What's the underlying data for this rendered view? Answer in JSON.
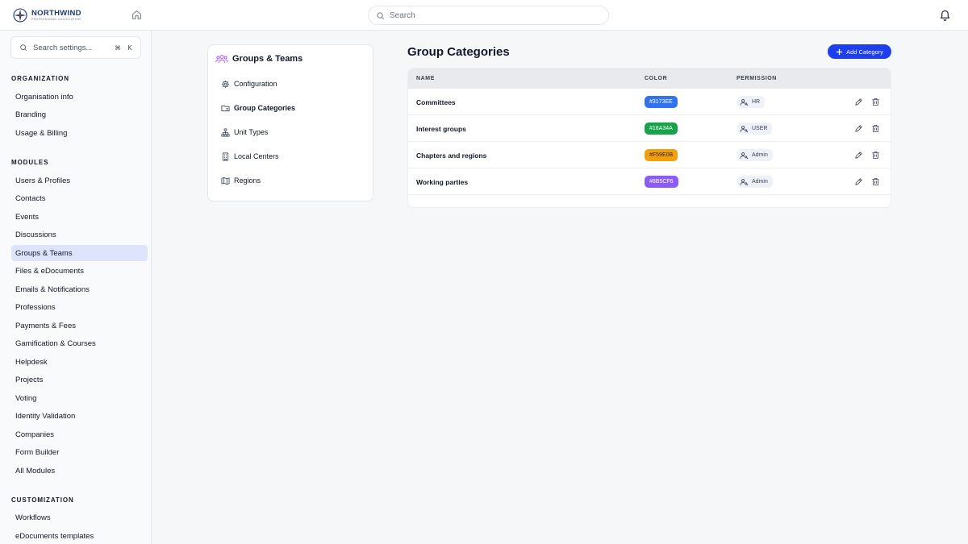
{
  "brand": {
    "name": "NORTHWIND",
    "tagline": "PROFESSIONAL ASSOCIATION"
  },
  "topbar": {
    "search_placeholder": "Search"
  },
  "sidebar": {
    "search_placeholder": "Search settings...",
    "shortcut": [
      "⌘",
      "K"
    ],
    "sections": [
      {
        "title": "ORGANIZATION",
        "items": [
          "Organisation info",
          "Branding",
          "Usage & Billing"
        ]
      },
      {
        "title": "MODULES",
        "items": [
          "Users & Profiles",
          "Contacts",
          "Events",
          "Discussions",
          "Groups & Teams",
          "Files & eDocuments",
          "Emails & Notifications",
          "Professions",
          "Payments & Fees",
          "Gamification & Courses",
          "Helpdesk",
          "Projects",
          "Voting",
          "Identity Validation",
          "Companies",
          "Form Builder",
          "All Modules"
        ]
      },
      {
        "title": "CUSTOMIZATION",
        "items": [
          "Workflows",
          "eDocuments templates"
        ]
      }
    ],
    "active_item": "Groups & Teams"
  },
  "subnav": {
    "title": "Groups & Teams",
    "items": [
      {
        "label": "Configuration",
        "icon": "gear-icon"
      },
      {
        "label": "Group Categories",
        "icon": "category-folder-icon"
      },
      {
        "label": "Unit Types",
        "icon": "hierarchy-icon"
      },
      {
        "label": "Local Centers",
        "icon": "building-icon"
      },
      {
        "label": "Regions",
        "icon": "map-icon"
      }
    ],
    "active_item": "Group Categories"
  },
  "main": {
    "title": "Group Categories",
    "add_button_label": "Add Category",
    "table": {
      "columns": [
        "NAME",
        "COLOR",
        "PERMISSION"
      ],
      "rows": [
        {
          "name": "Committees",
          "color": "#3173EE",
          "color_hex": "#3173EE",
          "permission": "HR"
        },
        {
          "name": "Interest groups",
          "color": "#16A34A",
          "color_hex": "#16A34A",
          "permission": "USER"
        },
        {
          "name": "Chapters and regions",
          "color": "#F59E0B",
          "color_hex": "#F59E0B",
          "permission": "Admin"
        },
        {
          "name": "Working parties",
          "color": "#8B5CF6",
          "color_hex": "#8B5CF6",
          "permission": "Admin"
        }
      ]
    }
  },
  "colors": {
    "accent": "#1d3ff0",
    "active_nav_bg": "#dde4fb",
    "subnav_icon": "#a855f7"
  }
}
